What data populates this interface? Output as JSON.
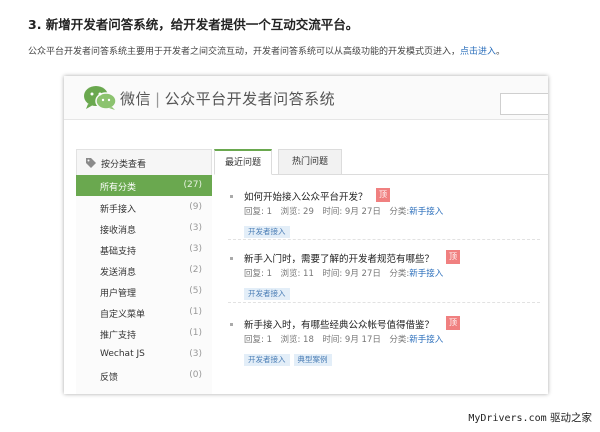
{
  "article": {
    "heading": "3. 新增开发者问答系统，给开发者提供一个互动交流平台。",
    "intro_text": "公众平台开发者问答系统主要用于开发者之间交流互动，开发者问答系统可以从高级功能的开发模式页进入，",
    "intro_link": "点击进入",
    "intro_end": "。"
  },
  "app": {
    "brand": "微信",
    "separator": "|",
    "title": "公众平台开发者问答系统",
    "brand_color": "#6aa84f"
  },
  "sidebar": {
    "title": "按分类查看",
    "items": [
      {
        "label": "所有分类",
        "count": "(27)",
        "active": true
      },
      {
        "label": "新手接入",
        "count": "(9)"
      },
      {
        "label": "接收消息",
        "count": "(3)"
      },
      {
        "label": "基础支持",
        "count": "(3)"
      },
      {
        "label": "发送消息",
        "count": "(2)"
      },
      {
        "label": "用户管理",
        "count": "(5)"
      },
      {
        "label": "自定义菜单",
        "count": "(1)"
      },
      {
        "label": "推广支持",
        "count": "(1)"
      },
      {
        "label": "Wechat JS",
        "count": "(3)"
      },
      {
        "label": "反馈",
        "count": "(0)"
      }
    ]
  },
  "tabs": [
    {
      "label": "最近问题",
      "active": true
    },
    {
      "label": "热门问题"
    }
  ],
  "questions": [
    {
      "title": "如何开始接入公众平台开发？",
      "badge": "顶",
      "meta": "回复: 1　浏览: 29　时间: 9月 27日　分类:",
      "category": "新手接入",
      "tags": [
        "开发者接入"
      ]
    },
    {
      "title": "新手入门时，需要了解的开发者规范有哪些？",
      "badge": "顶",
      "meta": "回复: 1　浏览: 11　时间: 9月 27日　分类:",
      "category": "新手接入",
      "tags": [
        "开发者接入"
      ]
    },
    {
      "title": "新手接入时，有哪些经典公众帐号值得借鉴？",
      "badge": "顶",
      "meta": "回复: 1　浏览: 18　时间: 9月 17日　分类:",
      "category": "新手接入",
      "tags": [
        "开发者接入",
        "典型案例"
      ]
    }
  ],
  "watermark": {
    "site": "MyDrivers.com",
    "cn": "驱动之家"
  }
}
